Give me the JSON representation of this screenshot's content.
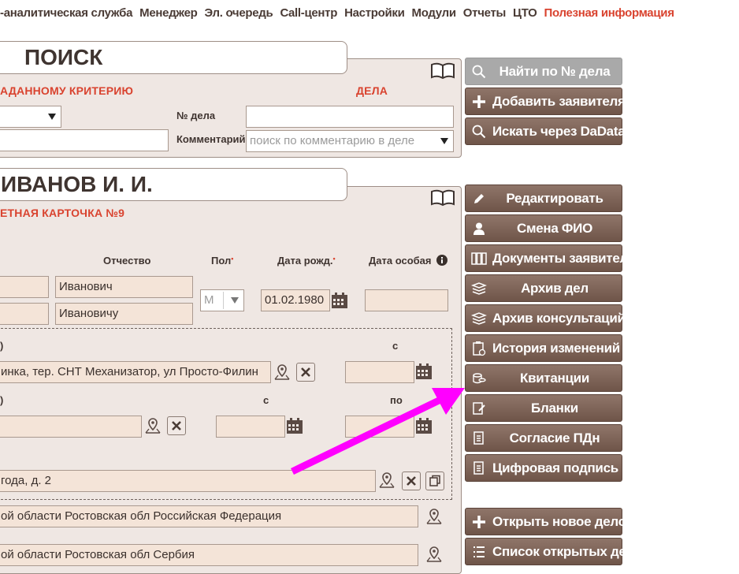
{
  "nav": {
    "items": [
      "-аналитическая служба",
      "Менеджер",
      "Эл. очередь",
      "Call-центр",
      "Настройки",
      "Модули",
      "Отчеты",
      "ЦТО"
    ],
    "active": "Полезная информация"
  },
  "search": {
    "title": "ПОИСК",
    "criterion": "АДАННОМУ КРИТЕРИЮ",
    "cases": "ДЕЛА",
    "case_no_label": "№ дела",
    "case_no_value": "",
    "comment_label": "Комментарий",
    "comment_placeholder": "поиск по комментарию в деле"
  },
  "person": {
    "title": "ИВАНОВ И. И.",
    "card": "ЕТНАЯ КАРТОЧКА №9",
    "patronymic_label": "Отчество",
    "sex_label": "Пол",
    "birth_label": "Дата рожд.",
    "special_label": "Дата особая",
    "patronymic": "Иванович",
    "patronymic_dative": "Ивановичу",
    "sex": "М",
    "birth_date": "01.02.1980",
    "addr1_label": ")",
    "addr1_from_label": "с",
    "addr1_value": "инка, тер. СНТ Механизатор, ул Просто-Филин",
    "addr2_label": ")",
    "addr2_from_label": "с",
    "addr2_to_label": "по",
    "addr3_value": "года, д. 2",
    "region1": "ой области Ростовская обл Российская Федерация",
    "region2": "ой области Ростовская обл Сербия"
  },
  "buttons": {
    "find": "Найти по № дела",
    "add_applicant": "Добавить заявителя",
    "dadata": "Искать через DaData",
    "edit": "Редактировать",
    "change_name": "Смена ФИО",
    "documents": "Документы заявителя",
    "archive_cases": "Архив дел",
    "archive_consult": "Архив консультаций",
    "history": "История изменений",
    "receipts": "Квитанции",
    "blanks": "Бланки",
    "consent": "Согласие ПДн",
    "signature": "Цифровая подпись",
    "open_case": "Открыть новое дело",
    "open_list": "Список открытых дел"
  },
  "colors": {
    "accent": "#d9432f",
    "button": "#7d6357",
    "arrow": "#ff00ff"
  }
}
